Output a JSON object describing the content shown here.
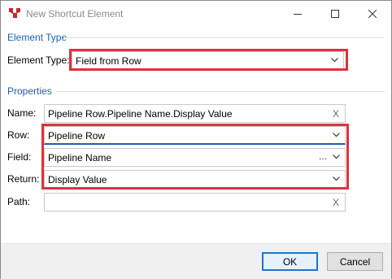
{
  "window": {
    "title": "New Shortcut Element"
  },
  "element_type_group": {
    "title": "Element Type",
    "label": "Element Type:",
    "value": "Field from Row"
  },
  "properties_group": {
    "title": "Properties",
    "name": {
      "label": "Name:",
      "value": "Pipeline Row.Pipeline Name.Display Value",
      "clear": "X"
    },
    "row": {
      "label": "Row:",
      "value": "Pipeline Row"
    },
    "field": {
      "label": "Field:",
      "value": "Pipeline Name",
      "browse": "..."
    },
    "return": {
      "label": "Return:",
      "value": "Display Value"
    },
    "path": {
      "label": "Path:",
      "value": "",
      "clear": "X"
    }
  },
  "buttons": {
    "ok": "OK",
    "cancel": "Cancel"
  },
  "colors": {
    "group_title": "#1660b8",
    "highlight": "#e0313d",
    "focus": "#1c5fb0"
  },
  "icons": [
    "app-icon",
    "minimize-icon",
    "maximize-icon",
    "close-icon",
    "chevron-down-icon"
  ]
}
